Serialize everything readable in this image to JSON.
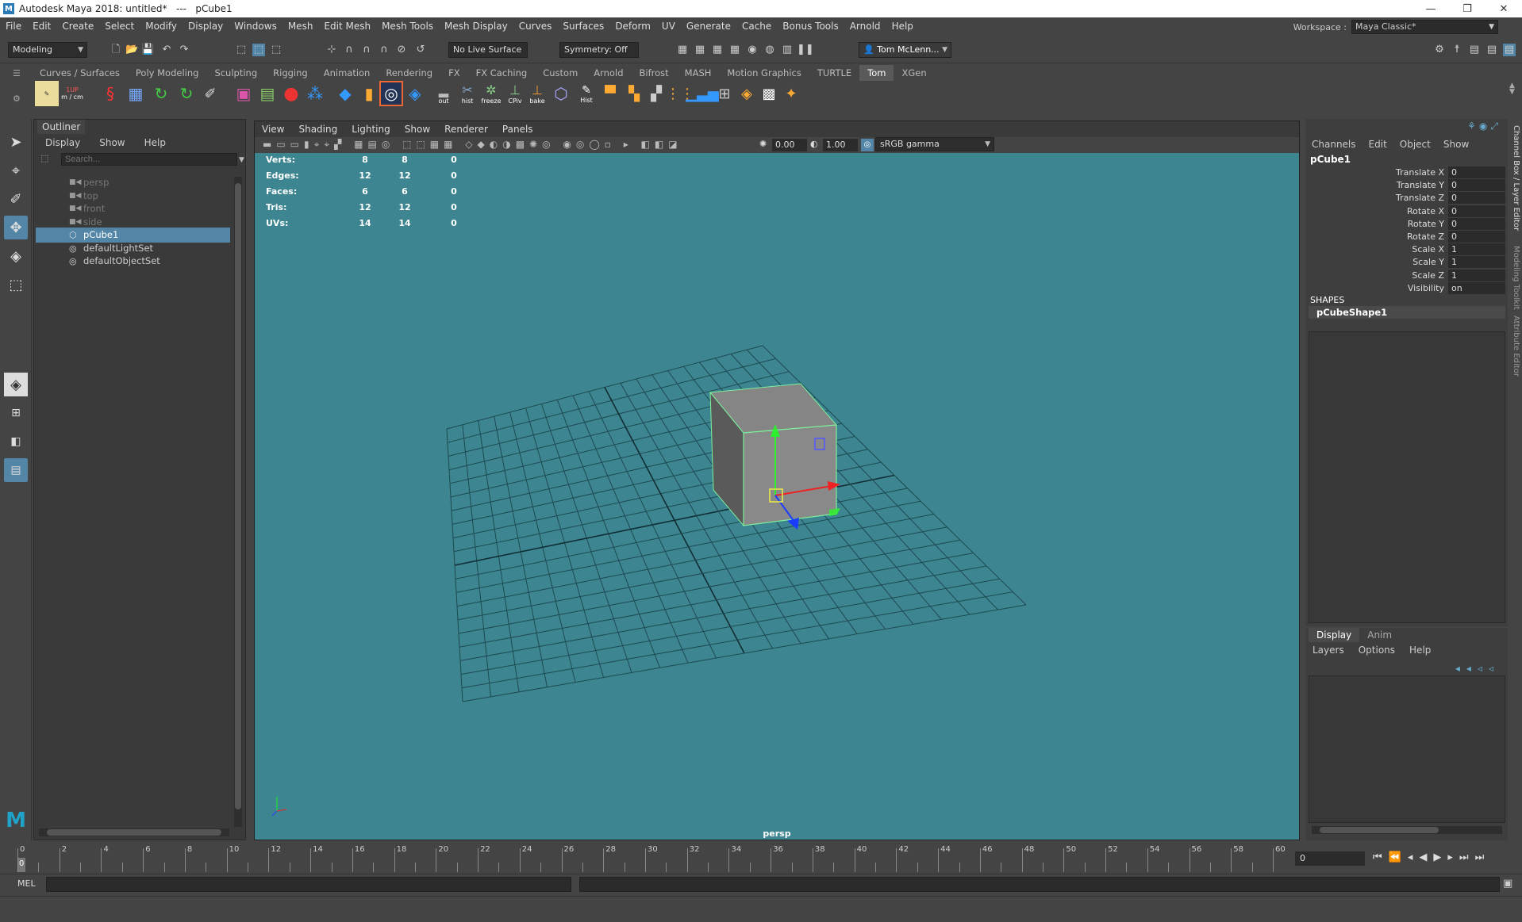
{
  "title": "Autodesk Maya 2018: untitled*   ---   pCube1",
  "logo_letter": "M",
  "window_controls": {
    "minimize": "—",
    "restore": "❐",
    "close": "✕"
  },
  "menubar": [
    "File",
    "Edit",
    "Create",
    "Select",
    "Modify",
    "Display",
    "Windows",
    "Mesh",
    "Edit Mesh",
    "Mesh Tools",
    "Mesh Display",
    "Curves",
    "Surfaces",
    "Deform",
    "UV",
    "Generate",
    "Cache",
    "Bonus Tools",
    "Arnold",
    "Help"
  ],
  "workspace": {
    "label": "Workspace :",
    "value": "Maya Classic*"
  },
  "statusline": {
    "mode": "Modeling",
    "live_surface": "No Live Surface",
    "symmetry": "Symmetry: Off",
    "user": "Tom McLenn..."
  },
  "shelf_tabs": [
    "Curves / Surfaces",
    "Poly Modeling",
    "Sculpting",
    "Rigging",
    "Animation",
    "Rendering",
    "FX",
    "FX Caching",
    "Custom",
    "Arnold",
    "Bifrost",
    "MASH",
    "Motion Graphics",
    "TURTLE",
    "Tom",
    "XGen"
  ],
  "shelf_active": "Tom",
  "shelf_labels": {
    "unit": "m / cm",
    "out": "out",
    "hist": "hist",
    "freeze": "freeze",
    "cpiv": "CPiv",
    "bake": "bake",
    "hist2": "Hist",
    "up": "1UP"
  },
  "outliner": {
    "tab": "Outliner",
    "menu": [
      "Display",
      "Show",
      "Help"
    ],
    "search_placeholder": "Search...",
    "items": [
      {
        "name": "persp",
        "dim": true,
        "icon": "camera-icon"
      },
      {
        "name": "top",
        "dim": true,
        "icon": "camera-icon"
      },
      {
        "name": "front",
        "dim": true,
        "icon": "camera-icon"
      },
      {
        "name": "side",
        "dim": true,
        "icon": "camera-icon"
      },
      {
        "name": "pCube1",
        "selected": true,
        "icon": "mesh-icon"
      },
      {
        "name": "defaultLightSet",
        "icon": "set-icon"
      },
      {
        "name": "defaultObjectSet",
        "icon": "set-icon"
      }
    ]
  },
  "viewport": {
    "menu": [
      "View",
      "Shading",
      "Lighting",
      "Show",
      "Renderer",
      "Panels"
    ],
    "exposure": "0.00",
    "gamma": "1.00",
    "colorspace": "sRGB gamma",
    "camera_label": "persp",
    "hud": [
      {
        "label": "Verts:",
        "a": "8",
        "b": "8",
        "c": "0"
      },
      {
        "label": "Edges:",
        "a": "12",
        "b": "12",
        "c": "0"
      },
      {
        "label": "Faces:",
        "a": "6",
        "b": "6",
        "c": "0"
      },
      {
        "label": "Tris:",
        "a": "12",
        "b": "12",
        "c": "0"
      },
      {
        "label": "UVs:",
        "a": "14",
        "b": "14",
        "c": "0"
      }
    ]
  },
  "channelbox": {
    "menu": [
      "Channels",
      "Edit",
      "Object",
      "Show"
    ],
    "object": "pCube1",
    "attrs": [
      {
        "name": "Translate X",
        "value": "0"
      },
      {
        "name": "Translate Y",
        "value": "0"
      },
      {
        "name": "Translate Z",
        "value": "0"
      },
      {
        "name": "Rotate X",
        "value": "0"
      },
      {
        "name": "Rotate Y",
        "value": "0"
      },
      {
        "name": "Rotate Z",
        "value": "0"
      },
      {
        "name": "Scale X",
        "value": "1"
      },
      {
        "name": "Scale Y",
        "value": "1"
      },
      {
        "name": "Scale Z",
        "value": "1"
      },
      {
        "name": "Visibility",
        "value": "on"
      }
    ],
    "shapes_header": "SHAPES",
    "shape": "pCubeShape1"
  },
  "side_tabs": [
    "Channel Box / Layer Editor",
    "Modeling Toolkit",
    "Attribute Editor"
  ],
  "layers": {
    "tabs": [
      "Display",
      "Anim"
    ],
    "menu": [
      "Layers",
      "Options",
      "Help"
    ]
  },
  "timeline": {
    "ticks": [
      "0",
      "2",
      "4",
      "6",
      "8",
      "10",
      "12",
      "14",
      "16",
      "18",
      "20",
      "22",
      "24",
      "26",
      "28",
      "30",
      "32",
      "34",
      "36",
      "38",
      "40",
      "42",
      "44",
      "46",
      "48",
      "50",
      "52",
      "54",
      "56",
      "58",
      "60"
    ],
    "current": "0",
    "current_frame_field": "0"
  },
  "cmdline": {
    "label": "MEL"
  },
  "colors": {
    "accent": "#5285a6",
    "viewport_bg": "#3d8591"
  }
}
